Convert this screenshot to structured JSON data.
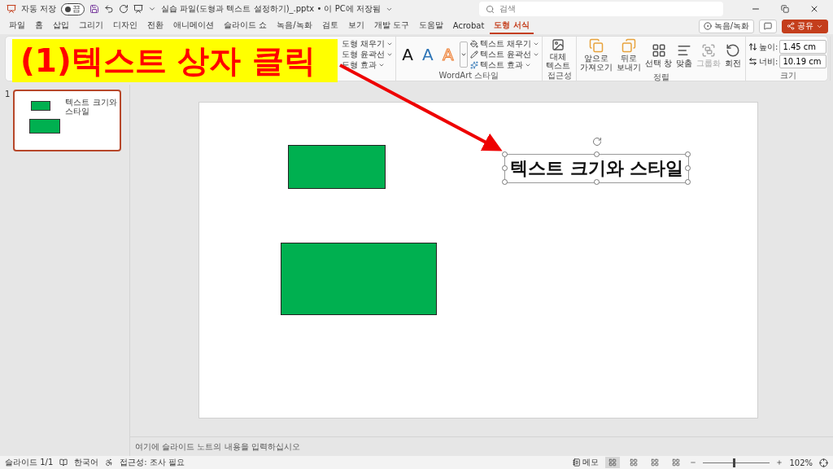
{
  "title_bar": {
    "autosave_label": "자동 저장",
    "autosave": {
      "on": false,
      "label": "끔"
    },
    "file_title": "실습 파일(도형과 텍스트 설정하기)_.pptx • 이 PC에 저장됨",
    "search_placeholder": "검색"
  },
  "menu_tabs": [
    {
      "label": "파일",
      "selected": false
    },
    {
      "label": "홈",
      "selected": false
    },
    {
      "label": "삽입",
      "selected": false
    },
    {
      "label": "그리기",
      "selected": false
    },
    {
      "label": "디자인",
      "selected": false
    },
    {
      "label": "전환",
      "selected": false
    },
    {
      "label": "애니메이션",
      "selected": false
    },
    {
      "label": "슬라이드 쇼",
      "selected": false
    },
    {
      "label": "녹음/녹화",
      "selected": false
    },
    {
      "label": "검토",
      "selected": false
    },
    {
      "label": "보기",
      "selected": false
    },
    {
      "label": "개발 도구",
      "selected": false
    },
    {
      "label": "도움말",
      "selected": false
    },
    {
      "label": "Acrobat",
      "selected": false
    },
    {
      "label": "도형 서식",
      "selected": true
    }
  ],
  "header_buttons": {
    "record": "녹음/녹화",
    "share": "공유"
  },
  "ribbon": {
    "shape_style_commands": [
      "도형 채우기",
      "도형 윤곽선",
      "도형 효과"
    ],
    "wordart": {
      "title": "WordArt 스타일",
      "samples": [
        {
          "kind": "plain",
          "label": "A"
        },
        {
          "kind": "blue",
          "label": "A"
        },
        {
          "kind": "outline",
          "label": "A"
        }
      ],
      "commands": [
        "텍스트 채우기",
        "텍스트 윤곽선",
        "텍스트 효과"
      ]
    },
    "accessibility": {
      "title": "접근성",
      "button": "대체\n텍스트"
    },
    "arrange": {
      "title": "정렬",
      "buttons": [
        {
          "kind": "forward",
          "label": "앞으로\n가져오기",
          "disabled": false
        },
        {
          "kind": "backward",
          "label": "뒤로\n보내기",
          "disabled": false
        },
        {
          "kind": "pane",
          "label": "선택 창",
          "disabled": false
        },
        {
          "kind": "align",
          "label": "맞춤",
          "disabled": false
        },
        {
          "kind": "group",
          "label": "그룹화",
          "disabled": true
        },
        {
          "kind": "rotate",
          "label": "회전",
          "disabled": false
        }
      ]
    },
    "size": {
      "title": "크기",
      "fields": [
        {
          "kind": "height",
          "label": "높이:",
          "value": "1.45 cm"
        },
        {
          "kind": "width",
          "label": "너비:",
          "value": "10.19 cm"
        }
      ]
    }
  },
  "thumbnail": {
    "number": "1",
    "text": "텍스트 크기와 스타일",
    "selected": true
  },
  "slide": {
    "textbox": {
      "text": "텍스트 크기와 스타일",
      "selected": true
    }
  },
  "notes_placeholder": "여기에 슬라이드 노트의 내용을 입력하십시오",
  "status_bar": {
    "slide": "슬라이드 1/1",
    "language": "한국어",
    "accessibility": "접근성: 조사 필요",
    "notes": "메모",
    "views": [
      {
        "selected": true
      },
      {
        "selected": false
      },
      {
        "selected": false
      },
      {
        "selected": false
      }
    ],
    "zoom_slider": {
      "level": 0.45
    },
    "zoom": "102%"
  },
  "annotation": {
    "text": "(1)텍스트 상자 클릭"
  }
}
